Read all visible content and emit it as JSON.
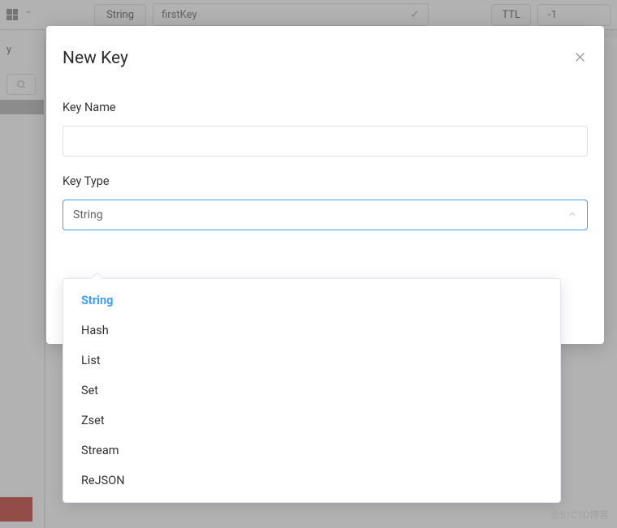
{
  "background": {
    "type_button": "String",
    "key_name_value": "firstKey",
    "ttl_label": "TTL",
    "ttl_value": "-1",
    "left_y": "y"
  },
  "modal": {
    "title": "New Key",
    "key_name_label": "Key Name",
    "key_name_value": "",
    "key_type_label": "Key Type",
    "selected_type": "String"
  },
  "dropdown": {
    "options": [
      "String",
      "Hash",
      "List",
      "Set",
      "Zset",
      "Stream",
      "ReJSON"
    ],
    "selected_index": 0
  },
  "watermark": "@51CTO博客"
}
